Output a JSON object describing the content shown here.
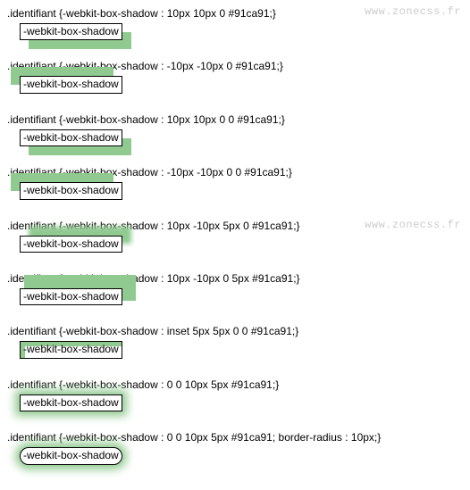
{
  "watermark": "www.zonecss.fr",
  "box_label": "-webkit-box-shadow",
  "entries": [
    {
      "code": ".identifiant {-webkit-box-shadow : 10px 10px 0 #91ca91;}"
    },
    {
      "code": ".identifiant {-webkit-box-shadow : -10px -10px 0 #91ca91;}"
    },
    {
      "code": ".identifiant {-webkit-box-shadow : 10px 10px 0 0 #91ca91;}"
    },
    {
      "code": ".identifiant {-webkit-box-shadow : -10px -10px 0 0 #91ca91;}"
    },
    {
      "code": ".identifiant {-webkit-box-shadow : 10px -10px 5px 0 #91ca91;}"
    },
    {
      "code": ".identifiant {-webkit-box-shadow : 10px -10px 0 5px #91ca91;}"
    },
    {
      "code": ".identifiant {-webkit-box-shadow : inset 5px 5px 0 0 #91ca91;}"
    },
    {
      "code": ".identifiant {-webkit-box-shadow : 0 0 10px 5px #91ca91;}"
    },
    {
      "code": ".identifiant {-webkit-box-shadow : 0 0 10px 5px #91ca91; border-radius : 10px;}"
    }
  ]
}
